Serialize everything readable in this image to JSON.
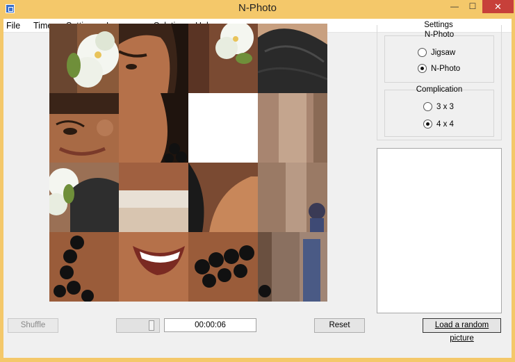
{
  "window": {
    "title": "N-Photo",
    "controls": {
      "minimize": "—",
      "maximize": "☐",
      "close": "✕"
    }
  },
  "menu": [
    "File",
    "Timer",
    "Settings",
    "Language",
    "Solution",
    "Help"
  ],
  "settings": {
    "title": "Settings",
    "mode_group": {
      "title": "N-Photo",
      "options": [
        {
          "label": "Jigsaw",
          "checked": false
        },
        {
          "label": "N-Photo",
          "checked": true
        }
      ]
    },
    "complication_group": {
      "title": "Complication",
      "options": [
        {
          "label": "3 x 3",
          "checked": false
        },
        {
          "label": "4 x 4",
          "checked": true
        }
      ]
    }
  },
  "board": {
    "grid": "4x4",
    "empty_tile": {
      "row": 2,
      "col": 3
    }
  },
  "controls": {
    "shuffle_label": "Shuffle",
    "timer_value": "00:00:06",
    "reset_label": "Reset",
    "load_random_label": "Load a random picture"
  },
  "colors": {
    "titlebar": "#f4c86a",
    "close_button": "#c7403a",
    "client_bg": "#f0f0f0"
  }
}
